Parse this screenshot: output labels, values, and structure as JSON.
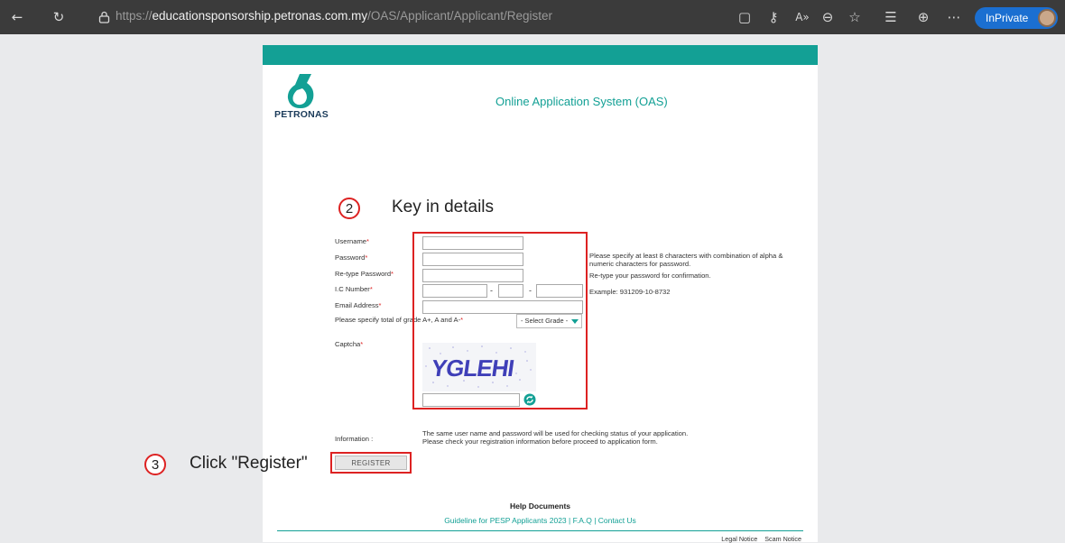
{
  "browser": {
    "url_scheme": "https://",
    "url_host": "educationsponsorship.petronas.com.my",
    "url_path": "/OAS/Applicant/Applicant/Register",
    "inprivate_label": "InPrivate"
  },
  "header": {
    "logo_text": "PETRONAS",
    "system_title": "Online Application System (OAS)"
  },
  "annotations": {
    "step2_number": "2",
    "step2_text": "Key in details",
    "step3_number": "3",
    "step3_text": "Click \"Register\""
  },
  "form": {
    "username_label": "Username",
    "password_label": "Password",
    "password_hint": "Please specify at least 8 characters with combination of alpha & numeric characters for password.",
    "retype_label": "Re-type Password",
    "retype_hint": "Re-type your password for confirmation.",
    "ic_label": "I.C Number",
    "ic_dash": "-",
    "ic_hint": "Example: 931209-10-8732",
    "email_label": "Email Address",
    "grade_label": "Please specify total of grade A+, A and A-",
    "grade_select_value": "- Select Grade -",
    "captcha_label": "Captcha",
    "captcha_text": "YGLEHI",
    "required_mark": "*"
  },
  "info": {
    "label": "Information :",
    "line1": "The same user name and password will be used for checking status of your application.",
    "line2": "Please check your registration information before proceed to application form."
  },
  "register_button": "REGISTER",
  "help": {
    "title": "Help Documents",
    "links": "Guideline for PESP Applicants 2023 | F.A.Q | Contact Us"
  },
  "footer": {
    "legal": "Legal Notice",
    "scam": "Scam Notice"
  },
  "colors": {
    "accent": "#13a095",
    "annotation_red": "#dd2222",
    "browser_bg": "#3b3b3b"
  }
}
